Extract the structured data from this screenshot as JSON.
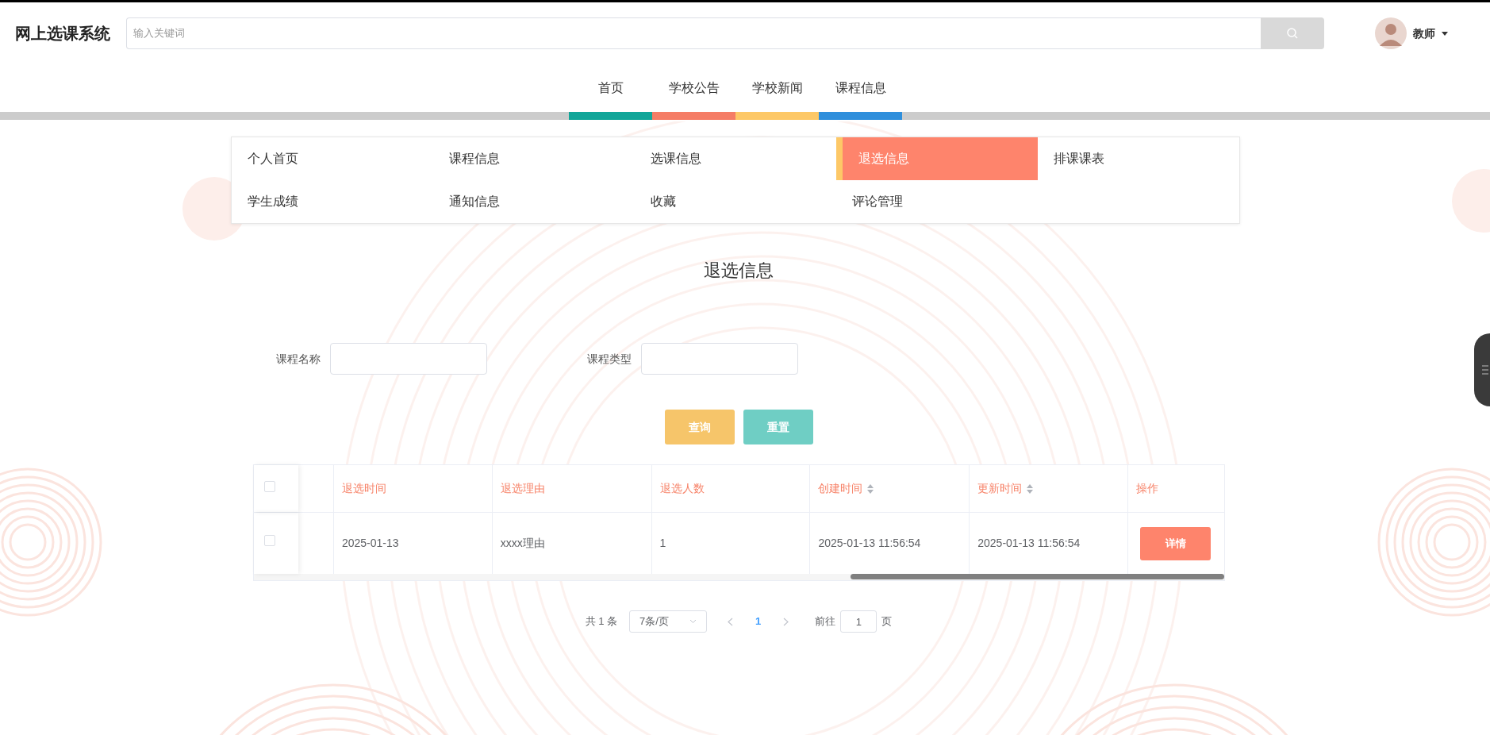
{
  "app": {
    "title": "网上选课系统"
  },
  "search": {
    "placeholder": "输入关键词"
  },
  "user": {
    "name": "教师"
  },
  "nav": [
    {
      "label": "首页",
      "color": "#12a699"
    },
    {
      "label": "学校公告",
      "color": "#f57d66"
    },
    {
      "label": "学校新闻",
      "color": "#fdc867"
    },
    {
      "label": "课程信息",
      "color": "#2f8fdc"
    }
  ],
  "menu": [
    {
      "label": "个人首页",
      "selected": false
    },
    {
      "label": "课程信息",
      "selected": false
    },
    {
      "label": "选课信息",
      "selected": false
    },
    {
      "label": "退选信息",
      "selected": true
    },
    {
      "label": "排课课表",
      "selected": false
    },
    {
      "label": "学生成绩",
      "selected": false
    },
    {
      "label": "通知信息",
      "selected": false
    },
    {
      "label": "收藏",
      "selected": false
    },
    {
      "label": "评论管理",
      "selected": false
    }
  ],
  "page_title": "退选信息",
  "filters": [
    {
      "label": "课程名称"
    },
    {
      "label": "课程类型"
    }
  ],
  "buttons": [
    {
      "label": "查询",
      "kind": "query"
    },
    {
      "label": "重置",
      "kind": "reset"
    }
  ],
  "table": {
    "header_checked": false,
    "columns": [
      {
        "label": "退选时间",
        "sortable": false
      },
      {
        "label": "退选理由",
        "sortable": false
      },
      {
        "label": "退选人数",
        "sortable": false
      },
      {
        "label": "创建时间",
        "sortable": true
      },
      {
        "label": "更新时间",
        "sortable": true
      },
      {
        "label": "操作",
        "sortable": false
      }
    ],
    "rows": [
      {
        "checked": false,
        "cells": [
          "2025-01-13",
          "xxxx理由",
          "1",
          "2025-01-13 11:56:54",
          "2025-01-13 11:56:54"
        ],
        "action": "详情"
      }
    ]
  },
  "pagination": {
    "total": "共 1 条",
    "page_size": "7条/页",
    "pages": [
      {
        "label": "1",
        "selected": true
      }
    ],
    "goto_label": "前往",
    "goto_value": "1",
    "page_suffix": "页"
  }
}
